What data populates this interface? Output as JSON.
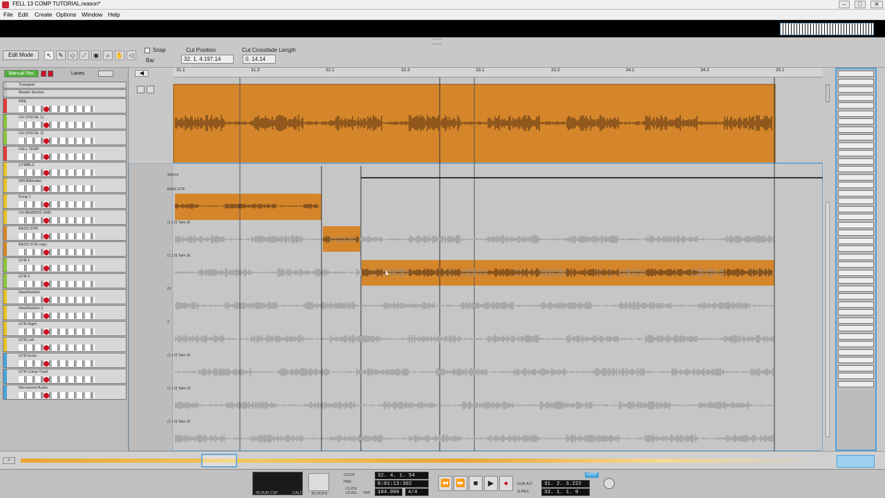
{
  "window": {
    "title": "FELL 13 COMP TUTORIAL.reason*",
    "minimize": "–",
    "maximize": "□",
    "close": "✕"
  },
  "menu": [
    "File",
    "Edit",
    "Create",
    "Options",
    "Window",
    "Help"
  ],
  "toolbar": {
    "edit_mode": "Edit Mode",
    "snap_label": "Snap",
    "snap_value": "Bar",
    "cut_position_label": "Cut Position",
    "cut_position_value": "32. 1. 4.197.14",
    "crossfade_label": "Cut Crossfade Length",
    "crossfade_value": "0. 14.14",
    "tools": [
      "pointer-icon",
      "pencil-icon",
      "eraser-icon",
      "razor-icon",
      "mute-icon",
      "magnify-icon",
      "hand-icon",
      "speaker-icon"
    ]
  },
  "tracklist_header": {
    "manual_rec": "Manual Rec",
    "lanes": "Lanes"
  },
  "tracks": [
    {
      "name": "Transport",
      "color": "#c0c0c0"
    },
    {
      "name": "Master Section",
      "color": "#c0c0c0"
    },
    {
      "name": "PRE",
      "color": "#e23b3b"
    },
    {
      "name": "CH (VOCAL 1)",
      "color": "#8cc43c"
    },
    {
      "name": "CH (VOCAL 2)",
      "color": "#8cc43c"
    },
    {
      "name": "FELL TEMP",
      "color": "#e23b3b"
    },
    {
      "name": "CYMBLS",
      "color": "#e8c22a"
    },
    {
      "name": "DRUMbinator",
      "color": "#e8c22a"
    },
    {
      "name": "Kong 1",
      "color": "#e8c22a"
    },
    {
      "name": "CH BKWRDS SNR",
      "color": "#e8c22a"
    },
    {
      "name": "BASS GTR",
      "color": "#d5862a"
    },
    {
      "name": "BASS GTR copy",
      "color": "#d5862a"
    },
    {
      "name": "GTR 1",
      "color": "#8cc43c"
    },
    {
      "name": "GTR 2",
      "color": "#8cc43c"
    },
    {
      "name": "NewSlowGtr",
      "color": "#e8c22a"
    },
    {
      "name": "NewSlowGtr 2",
      "color": "#e8c22a"
    },
    {
      "name": "GTR Right",
      "color": "#e8c22a"
    },
    {
      "name": "GTR Left",
      "color": "#e8c22a"
    },
    {
      "name": "GTR Echo",
      "color": "#4aa3d8"
    },
    {
      "name": "GTR Comp Track",
      "color": "#4aa3d8"
    },
    {
      "name": "Recovered Audio",
      "color": "#4aa3d8"
    }
  ],
  "ruler": [
    "31.1",
    "31.3",
    "32.1",
    "32.3",
    "33.1",
    "33.3",
    "34.1",
    "34.3",
    "35.1"
  ],
  "lanes": {
    "silence_label": "Silence",
    "comp_label": "BASS GTR",
    "take_labels": [
      "(1.1.0) Take 22",
      "(1.1.0) Take 26",
      "01",
      "2",
      "(1.1.0) Take 25",
      "(1.1.0) Take 23",
      "(1.1.0) Take 20"
    ]
  },
  "transport": {
    "position_bars": "32. 4. 1. 54",
    "position_time": "0:01:13:302",
    "tempo": "104.000",
    "signature": "4/4",
    "loop_left": "31. 2. 3.222",
    "loop_right": "33. 1. 1. 0",
    "loop_label": "LOOP",
    "click_label": "CLICK",
    "pre_label": "PRE",
    "click_level": "CLICK LEVEL",
    "tap_label": "TAP",
    "blocks_label": "BLOCKS",
    "dub_alt": "DUB ALT",
    "q_rec": "Q REC",
    "in_out": "IN DUR CSP",
    "calc": "CALC"
  },
  "colors": {
    "accent": "#4aa3d8",
    "clip": "#d5862a",
    "waveform": "#4a2a10"
  }
}
